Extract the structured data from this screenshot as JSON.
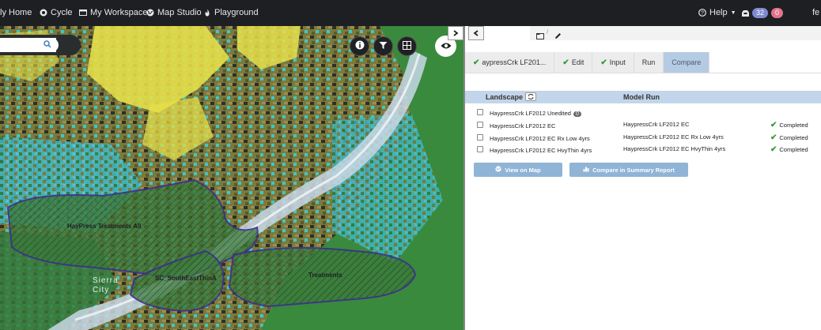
{
  "navbar": {
    "items": [
      {
        "label": "ly Home",
        "icon": "home-icon"
      },
      {
        "label": "Cycle",
        "icon": "cycle-icon"
      },
      {
        "label": "My Workspace",
        "icon": "workspace-icon"
      },
      {
        "label": "Map Studio",
        "icon": "globe-icon"
      },
      {
        "label": "Playground",
        "icon": "fire-icon"
      }
    ],
    "help_label": "Help",
    "inbox_count_a": "32",
    "inbox_count_b": "0",
    "user_initials": "fe"
  },
  "map": {
    "search_placeholder": "",
    "labels": {
      "area1": "HayPress Treatments All",
      "area2": "SC_SouthEastThinA",
      "area3": "Treatments",
      "town": "Sierra City"
    },
    "controls": [
      "info-icon",
      "filter-icon",
      "layers-icon",
      "eye-icon"
    ]
  },
  "panel": {
    "tabs": [
      {
        "label": "aypressCrk LF201...",
        "checked": true
      },
      {
        "label": "Edit",
        "checked": true
      },
      {
        "label": "Input",
        "checked": true
      },
      {
        "label": "Run",
        "checked": false
      },
      {
        "label": "Compare",
        "checked": false,
        "active": true
      }
    ],
    "table": {
      "col_landscape": "Landscape",
      "col_model_run": "Model Run",
      "rows": [
        {
          "landscape": "HaypressCrk LF2012 Unedited",
          "badge": "0",
          "run": "",
          "status": ""
        },
        {
          "landscape": "HaypressCrk LF2012 EC",
          "badge": "",
          "run": "HaypressCrk LF2012 EC",
          "status": "Completed"
        },
        {
          "landscape": "HaypressCrk LF2012 EC Rx Low 4yrs",
          "badge": "",
          "run": "HaypressCrk LF2012 EC Rx Low 4yrs",
          "status": "Completed"
        },
        {
          "landscape": "HaypressCrk LF2012 EC HvyThin 4yrs",
          "badge": "",
          "run": "HaypressCrk LF2012 EC HvyThin 4yrs",
          "status": "Completed"
        }
      ]
    },
    "buttons": {
      "view_on_map": "View on Map",
      "compare_summary": "Compare in Summary Report"
    }
  },
  "colors": {
    "navbar_bg": "#1d1f22",
    "tab_active": "#b5cbe3",
    "table_header": "#c3d5ea",
    "button": "#8fb4d6",
    "status_green": "#3a9a3a"
  }
}
